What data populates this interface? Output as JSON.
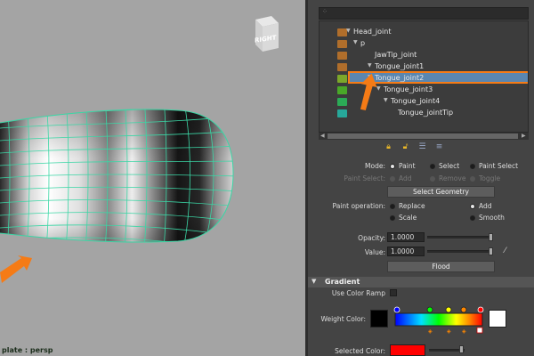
{
  "viewport": {
    "viewcube_label": "RIGHT",
    "status_text": "plate : persp"
  },
  "outliner": {
    "search_placeholder": "",
    "items": [
      {
        "label": "Head_joint",
        "swatch": "#b06e2b",
        "arrow": "▼"
      },
      {
        "label": "p",
        "swatch": "#b06e2b",
        "arrow": "▼"
      },
      {
        "label": "JawTip_joint",
        "swatch": "#b06e2b",
        "arrow": ""
      },
      {
        "label": "Tongue_joint1",
        "swatch": "#b06e2b",
        "arrow": "▼"
      },
      {
        "label": "Tongue_joint2",
        "swatch": "#7ca82a",
        "arrow": "▼",
        "selected": true
      },
      {
        "label": "Tongue_joint3",
        "swatch": "#49a828",
        "arrow": "▼"
      },
      {
        "label": "Tongue_joint4",
        "swatch": "#2bab56",
        "arrow": "▼"
      },
      {
        "label": "Tongue_jointTip",
        "swatch": "#27a89a",
        "arrow": ""
      }
    ]
  },
  "icons": [
    "lock-icon",
    "lock-open-icon",
    "list-icon",
    "list-sort-icon"
  ],
  "form": {
    "mode_label": "Mode:",
    "mode_options": [
      "Paint",
      "Select",
      "Paint Select"
    ],
    "paint_select_label": "Paint Select:",
    "paint_select_options": [
      "Add",
      "Remove",
      "Toggle"
    ],
    "select_geometry_label": "Select Geometry",
    "paint_operation_label": "Paint operation:",
    "paint_operations": [
      "Replace",
      "Add",
      "Scale",
      "Smooth"
    ],
    "opacity_label": "Opacity:",
    "opacity_value": "1.0000",
    "value_label": "Value:",
    "value_value": "1.0000",
    "flood_label": "Flood"
  },
  "gradient": {
    "title": "Gradient",
    "use_color_ramp_label": "Use Color Ramp",
    "weight_color_label": "Weight Color:",
    "selected_color_label": "Selected Color:",
    "weight_color": "#000000",
    "end_color": "#ffffff",
    "selected_color": "#ff0000"
  },
  "colors": {
    "selection_fill": "#5a86b0",
    "annotation_orange": "#f57b16",
    "wireframe": "#3bd6a5"
  }
}
